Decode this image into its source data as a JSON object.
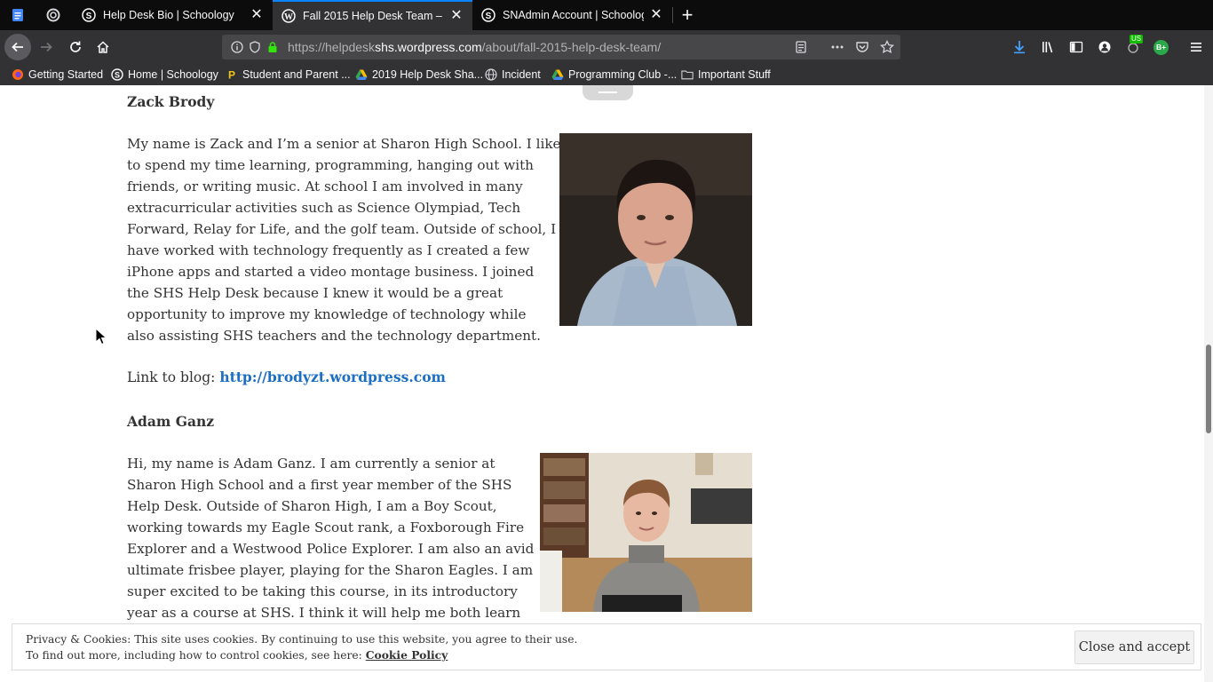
{
  "browser": {
    "tabs": [
      {
        "title": "Help Desk Bio | Schoology",
        "active": false
      },
      {
        "title": "Fall 2015 Help Desk Team – SHS",
        "active": true
      },
      {
        "title": "SNAdmin Account | Schoology",
        "active": false
      }
    ],
    "url": {
      "prefix": "https://helpdesk",
      "domain": "shs.wordpress.com",
      "path": "/about/fall-2015-help-desk-team/"
    },
    "badges": {
      "extension": "US",
      "profile": "B+"
    },
    "bookmarks": [
      "Getting Started",
      "Home | Schoology",
      "Student and Parent ...",
      "2019 Help Desk Sha...",
      "Incident",
      "Programming Club -...",
      "Important Stuff"
    ]
  },
  "page": {
    "members": [
      {
        "name": "Zack Brody",
        "bio_lines": [
          "My name is Zack and I’m a senior at Sharon High School. I like",
          "to spend my time learning, programming, hanging out with",
          "friends, or writing music. At school I am involved in many",
          "extracurricular activities such as Science Olympiad, Tech",
          "Forward, Relay for Life, and the golf team. Outside of school, I",
          "have worked with technology frequently as I created a few",
          "iPhone apps and started a video montage business. I joined",
          "the SHS Help Desk because I knew it would be a great",
          "opportunity to improve my knowledge of technology while",
          "also assisting SHS teachers and the technology department."
        ],
        "blog_label": "Link to blog:",
        "blog_url": "http://brodyzt.wordpress.com"
      },
      {
        "name": "Adam Ganz",
        "bio_lines": [
          "Hi, my name is Adam Ganz. I am currently a senior at",
          "Sharon High School and a first year member of the SHS",
          "Help Desk. Outside of Sharon High, I am a Boy Scout,",
          "working towards my Eagle Scout rank, a Foxborough Fire",
          "Explorer and a Westwood Police Explorer. I am also an avid",
          "ultimate frisbee player, playing for the Sharon Eagles. I am",
          "super excited to be taking this course, in its introductory",
          "year as a course at SHS. I think it will help me both learn"
        ]
      }
    ]
  },
  "cookie_bar": {
    "line1": "Privacy & Cookies: This site uses cookies. By continuing to use this website, you agree to their use.",
    "line2_prefix": "To find out more, including how to control cookies, see here: ",
    "policy_link": "Cookie Policy",
    "button": "Close and accept"
  }
}
